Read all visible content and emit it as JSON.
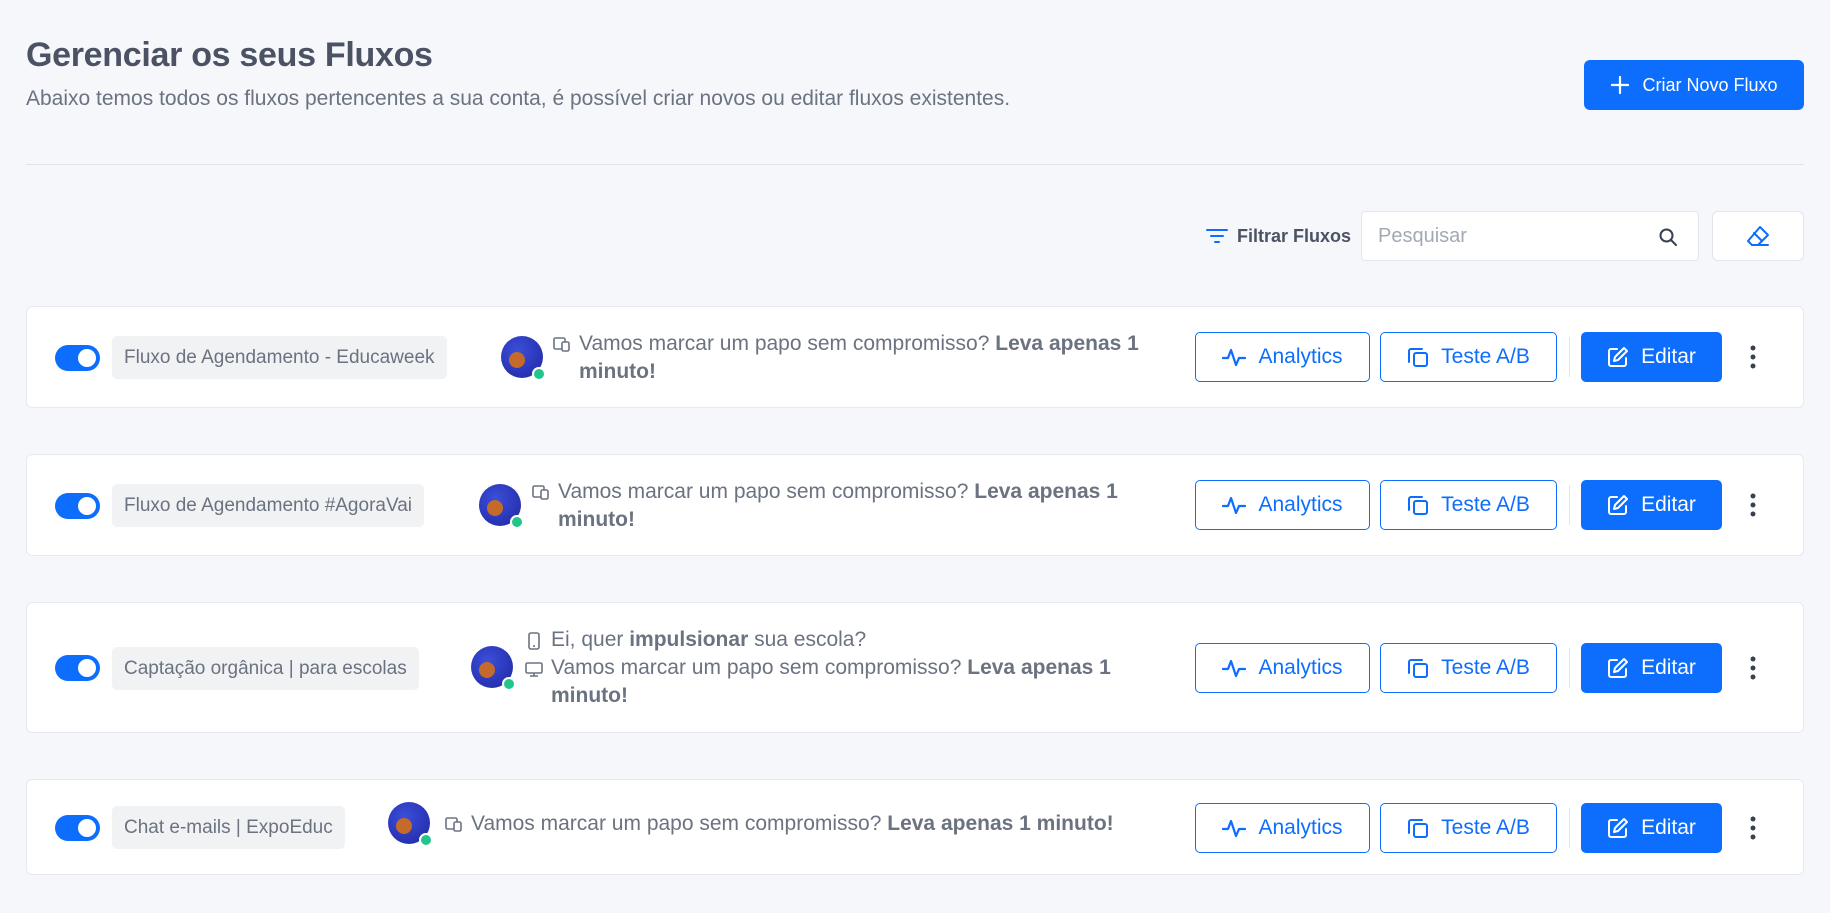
{
  "header": {
    "title": "Gerenciar os seus Fluxos",
    "subtitle": "Abaixo temos todos os fluxos pertencentes a sua conta, é possível criar novos ou editar fluxos existentes.",
    "create_button": "Criar Novo Fluxo"
  },
  "toolbar": {
    "filter_label": "Filtrar Fluxos",
    "search_placeholder": "Pesquisar",
    "search_value": ""
  },
  "buttons": {
    "analytics": "Analytics",
    "ab_test": "Teste A/B",
    "edit": "Editar"
  },
  "colors": {
    "accent": "#0d6efd",
    "status_online": "#22c58b",
    "background": "#f5f7fb"
  },
  "flows": [
    {
      "enabled": true,
      "name": "Fluxo de Agendamento - Educaweek",
      "messages": [
        {
          "device": "multi-device-icon",
          "text": "Vamos marcar um papo sem compromisso? ",
          "bold": "Leva apenas 1 minuto!"
        }
      ]
    },
    {
      "enabled": true,
      "name": "Fluxo de Agendamento #AgoraVai",
      "messages": [
        {
          "device": "multi-device-icon",
          "text": "Vamos marcar um papo sem compromisso? ",
          "bold": "Leva apenas 1 minuto!"
        }
      ]
    },
    {
      "enabled": true,
      "name": "Captação orgânica | para escolas",
      "messages": [
        {
          "device": "mobile-icon",
          "text": "Ei, quer ",
          "bold": "impulsionar",
          "tail": " sua escola?"
        },
        {
          "device": "desktop-icon",
          "text": "Vamos marcar um papo sem compromisso? ",
          "bold": "Leva apenas 1 minuto!"
        }
      ]
    },
    {
      "enabled": true,
      "name": "Chat e-mails | ExpoEduc",
      "messages": [
        {
          "device": "multi-device-icon",
          "text": "Vamos marcar um papo sem compromisso? ",
          "bold": "Leva apenas 1 minuto!"
        }
      ]
    }
  ]
}
